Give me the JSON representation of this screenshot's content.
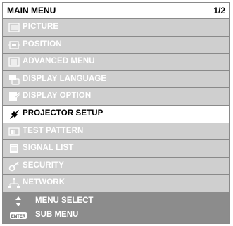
{
  "header": {
    "title": "MAIN MENU",
    "page": "1/2"
  },
  "menu": {
    "items": [
      {
        "label": "PICTURE",
        "icon": "picture-icon"
      },
      {
        "label": "POSITION",
        "icon": "position-icon"
      },
      {
        "label": "ADVANCED MENU",
        "icon": "advanced-menu-icon"
      },
      {
        "label": "DISPLAY LANGUAGE",
        "icon": "display-language-icon"
      },
      {
        "label": "DISPLAY OPTION",
        "icon": "display-option-icon"
      },
      {
        "label": "PROJECTOR SETUP",
        "icon": "projector-setup-icon",
        "selected": true
      },
      {
        "label": "TEST PATTERN",
        "icon": "test-pattern-icon"
      },
      {
        "label": "SIGNAL LIST",
        "icon": "signal-list-icon"
      },
      {
        "label": "SECURITY",
        "icon": "security-icon"
      },
      {
        "label": "NETWORK",
        "icon": "network-icon"
      }
    ]
  },
  "footer": {
    "menu_select": {
      "icon": "up-down-arrows-icon",
      "label": "MENU SELECT"
    },
    "sub_menu": {
      "icon": "enter-key-icon",
      "key_text": "ENTER",
      "label": "SUB MENU"
    }
  },
  "colors": {
    "item_bg": "#cfcfcf",
    "selected_bg": "#ffffff",
    "footer_bg": "#8c8c8c"
  }
}
